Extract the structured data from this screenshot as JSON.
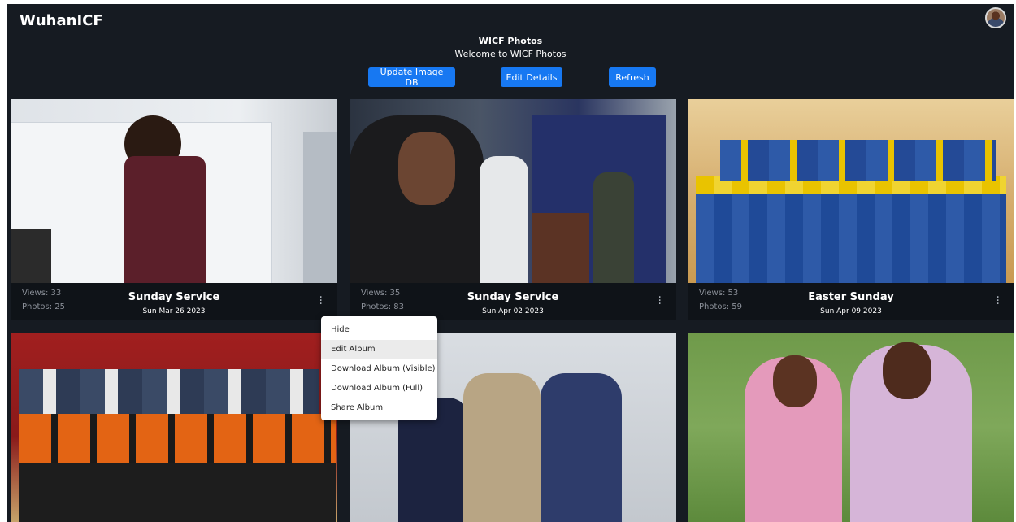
{
  "header": {
    "brand": "WuhanICF",
    "title": "WICF Photos",
    "subtitle": "Welcome to WICF Photos"
  },
  "toolbar": {
    "update_label": "Update Image DB",
    "edit_label": "Edit Details",
    "refresh_label": "Refresh"
  },
  "albums": [
    {
      "title": "Sunday Service",
      "date": "Sun Mar 26 2023",
      "views": "Views: 33",
      "photos": "Photos: 25"
    },
    {
      "title": "Sunday Service",
      "date": "Sun Apr 02 2023",
      "views": "Views: 35",
      "photos": "Photos: 83"
    },
    {
      "title": "Easter Sunday",
      "date": "Sun Apr 09 2023",
      "views": "Views: 53",
      "photos": "Photos: 59"
    }
  ],
  "context_menu": {
    "items": [
      "Hide",
      "Edit Album",
      "Download Album (Visible)",
      "Download Album (Full)",
      "Share Album"
    ],
    "highlighted": "Edit Album"
  },
  "icons": {
    "avatar": "user-avatar",
    "more": "kebab-menu-icon"
  },
  "colors": {
    "background": "#161b22",
    "accent": "#1778f2"
  }
}
